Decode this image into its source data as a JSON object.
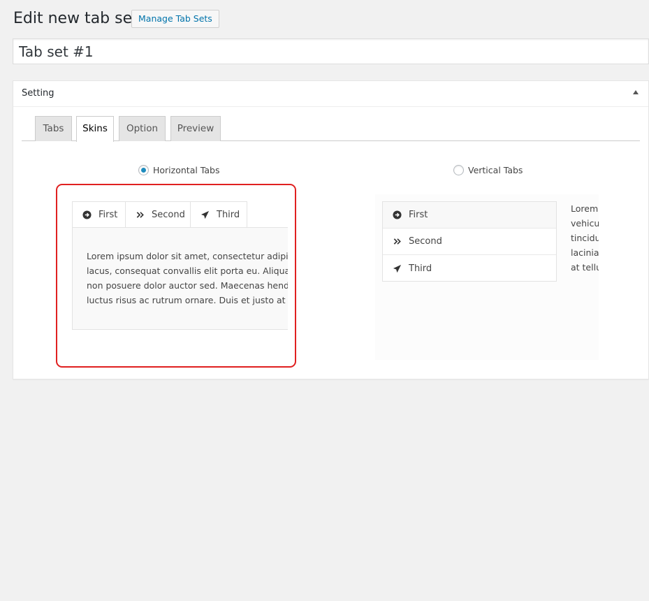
{
  "header": {
    "title": "Edit new tab set",
    "manage_button": "Manage Tab Sets"
  },
  "title_field": {
    "value": "Tab set #1"
  },
  "metabox": {
    "title": "Setting",
    "tabs": [
      {
        "label": "Tabs"
      },
      {
        "label": "Skins",
        "active": true
      },
      {
        "label": "Option"
      },
      {
        "label": "Preview"
      }
    ]
  },
  "skins": {
    "horizontal": {
      "label": "Horizontal Tabs",
      "selected": true,
      "tabs": [
        {
          "icon": "arrow-circle-right-icon",
          "label": "First"
        },
        {
          "icon": "double-chevron-right-icon",
          "label": "Second"
        },
        {
          "icon": "paper-plane-icon",
          "label": "Third"
        }
      ],
      "content_lines": [
        "Lorem ipsum dolor sit amet, consectetur adipis",
        "lacus, consequat convallis elit porta eu. Aliquar",
        "non posuere dolor auctor sed. Maecenas hend",
        "luctus risus ac rutrum ornare. Duis et justo at te"
      ]
    },
    "vertical": {
      "label": "Vertical Tabs",
      "selected": false,
      "tabs": [
        {
          "icon": "arrow-circle-right-icon",
          "label": "First"
        },
        {
          "icon": "double-chevron-right-icon",
          "label": "Second"
        },
        {
          "icon": "paper-plane-icon",
          "label": "Third"
        }
      ],
      "content_lines": [
        "Lorem",
        "vehicu",
        "tincidu",
        "lacinia",
        "at tellu"
      ]
    }
  },
  "colors": {
    "accent": "#0073aa",
    "radio_checked": "#1e8cbe",
    "highlight_border": "#e02020",
    "background": "#f1f1f1"
  }
}
